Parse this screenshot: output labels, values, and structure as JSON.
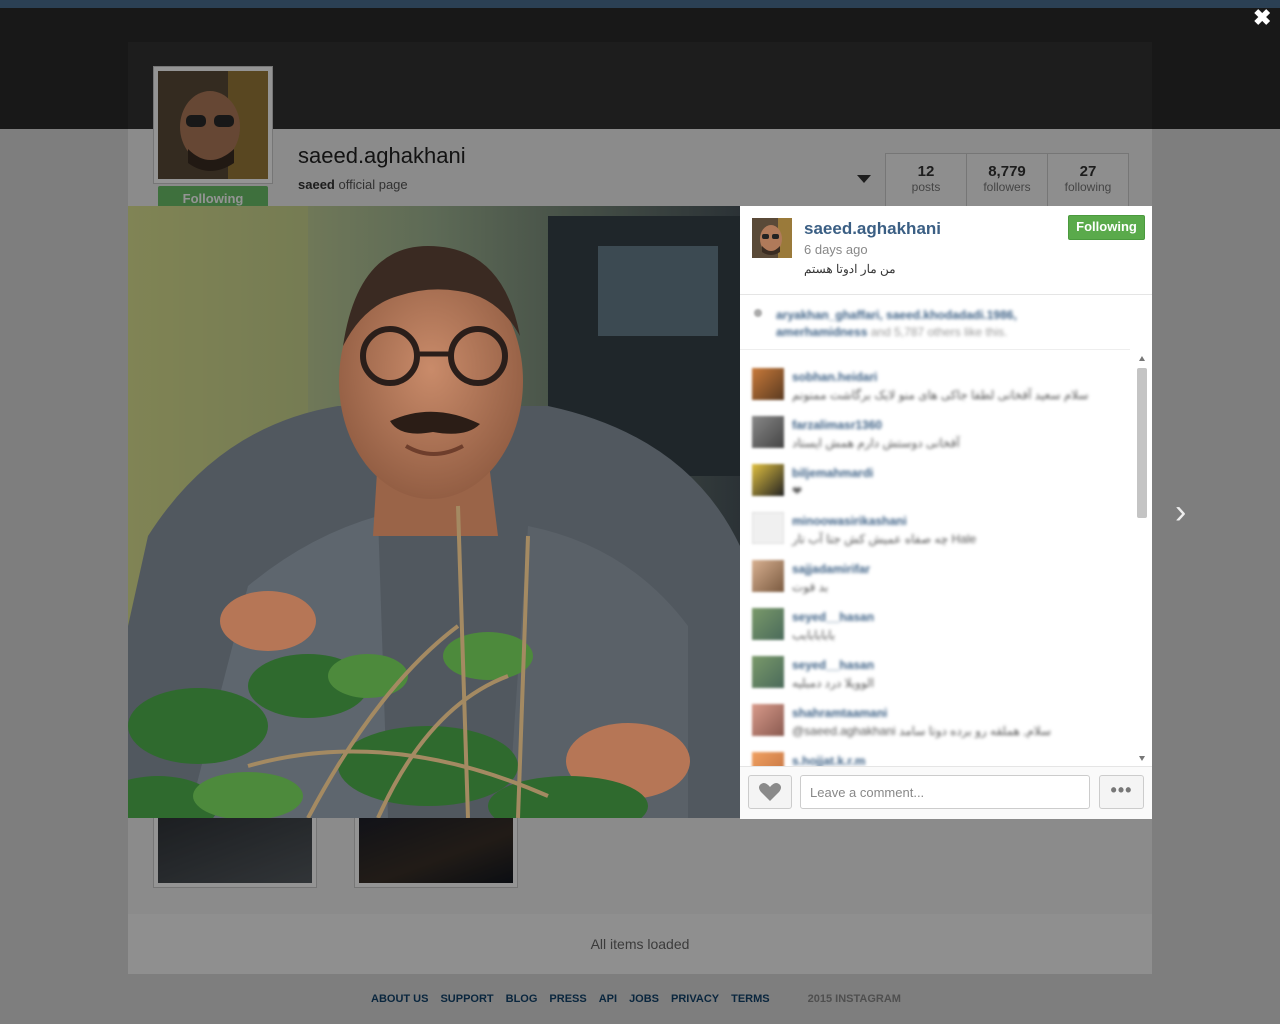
{
  "profile": {
    "username": "saeed.aghakhani",
    "bio_name": "saeed",
    "bio_text": " official page",
    "follow_label": "Following",
    "stats": [
      {
        "num": "12",
        "label": "posts"
      },
      {
        "num": "8,779",
        "label": "followers"
      },
      {
        "num": "27",
        "label": "following"
      }
    ]
  },
  "page": {
    "all_loaded": "All items loaded",
    "footer_links": [
      "ABOUT US",
      "SUPPORT",
      "BLOG",
      "PRESS",
      "API",
      "JOBS",
      "PRIVACY",
      "TERMS"
    ],
    "copyright": "2015 INSTAGRAM"
  },
  "post": {
    "username": "saeed.aghakhani",
    "time": "6 days ago",
    "caption": "من مار ادوتا هستم",
    "follow_label": "Following",
    "likes_users": "aryakhan_ghaffari, saeed.khodadadi.1986, amerhamidness",
    "likes_rest": " and 5,787 others like this.",
    "comments": [
      {
        "user": "sobhan.heidari",
        "text": "سلام سعید آقخانی لطفا جاکی های منو لایک برگاشت ممنونم"
      },
      {
        "user": "farzalimasr1360",
        "text": "آقخانی دوستش دارم همش ایستاد"
      },
      {
        "user": "biljemahmardi",
        "text": "❤"
      },
      {
        "user": "minoowasirikashani",
        "text": "چه صفاه عمیش کش جتا آب تار Hale"
      },
      {
        "user": "sajjadamirifar",
        "text": "بد قوت"
      },
      {
        "user": "seyed__hasan",
        "text": "بابابابابب"
      },
      {
        "user": "seyed__hasan",
        "text": "الوویلا درد دمبلیه"
      },
      {
        "user": "shahramtaamani",
        "text": "@saeed.aghakhani سلام, هملقه رو برده دوتا سامد"
      },
      {
        "user": "s.hojjat.k.r.m",
        "text": ""
      }
    ],
    "comment_placeholder": "Leave a comment...",
    "more_label": "•••"
  },
  "icons": {
    "close": "✖",
    "next": "›"
  }
}
